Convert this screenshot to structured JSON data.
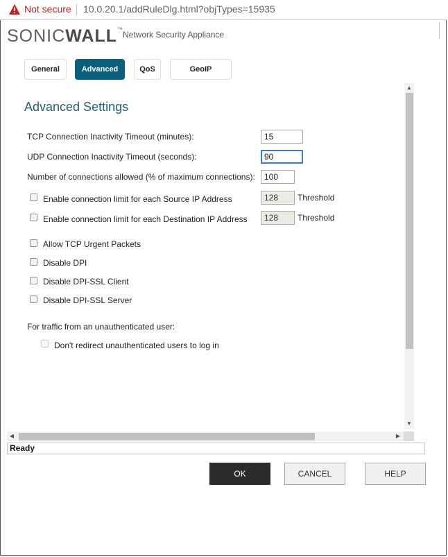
{
  "address_bar": {
    "security_label": "Not secure",
    "url": "10.0.20.1/addRuleDlg.html?objTypes=15935"
  },
  "header": {
    "logo_part1": "SONIC",
    "logo_part2": "WALL",
    "logo_tm": "™",
    "app_name": "Network Security Appliance"
  },
  "tabs": [
    {
      "label": "General",
      "active": false
    },
    {
      "label": "Advanced",
      "active": true
    },
    {
      "label": "QoS",
      "active": false
    },
    {
      "label": "GeoIP",
      "active": false
    }
  ],
  "section": {
    "title": "Advanced Settings",
    "fields": {
      "tcp_timeout": {
        "label": "TCP Connection Inactivity Timeout (minutes):",
        "value": "15"
      },
      "udp_timeout": {
        "label": "UDP Connection Inactivity Timeout (seconds):",
        "value": "90"
      },
      "max_connections": {
        "label": "Number of connections allowed (% of maximum connections):",
        "value": "100"
      },
      "src_limit": {
        "label": "Enable connection limit for each Source IP Address",
        "checked": false,
        "value": "128",
        "suffix": "Threshold"
      },
      "dst_limit": {
        "label": "Enable connection limit for each Destination IP Address",
        "checked": false,
        "value": "128",
        "suffix": "Threshold"
      }
    },
    "checkboxes": {
      "tcp_urgent": {
        "label": "Allow TCP Urgent Packets",
        "checked": false
      },
      "disable_dpi": {
        "label": "Disable DPI",
        "checked": false
      },
      "dpi_ssl_client": {
        "label": "Disable DPI-SSL Client",
        "checked": false
      },
      "dpi_ssl_server": {
        "label": "Disable DPI-SSL Server",
        "checked": false
      }
    },
    "unauth": {
      "label": "For traffic from an unauthenticated user:",
      "no_redirect": {
        "label": "Don't redirect unauthenticated users to log in",
        "checked": false,
        "disabled": true
      }
    }
  },
  "status": {
    "text": "Ready"
  },
  "buttons": {
    "ok": "OK",
    "cancel": "CANCEL",
    "help": "HELP"
  },
  "icons": {
    "warning": "warning-triangle-icon",
    "scroll_up": "arrow-up-icon",
    "scroll_down": "arrow-down-icon",
    "scroll_left": "arrow-left-icon",
    "scroll_right": "arrow-right-icon"
  },
  "colors": {
    "accent": "#0b5f7e",
    "title": "#1f5e7c",
    "warning": "#c5221f",
    "ok_button": "#2b2b2b"
  }
}
